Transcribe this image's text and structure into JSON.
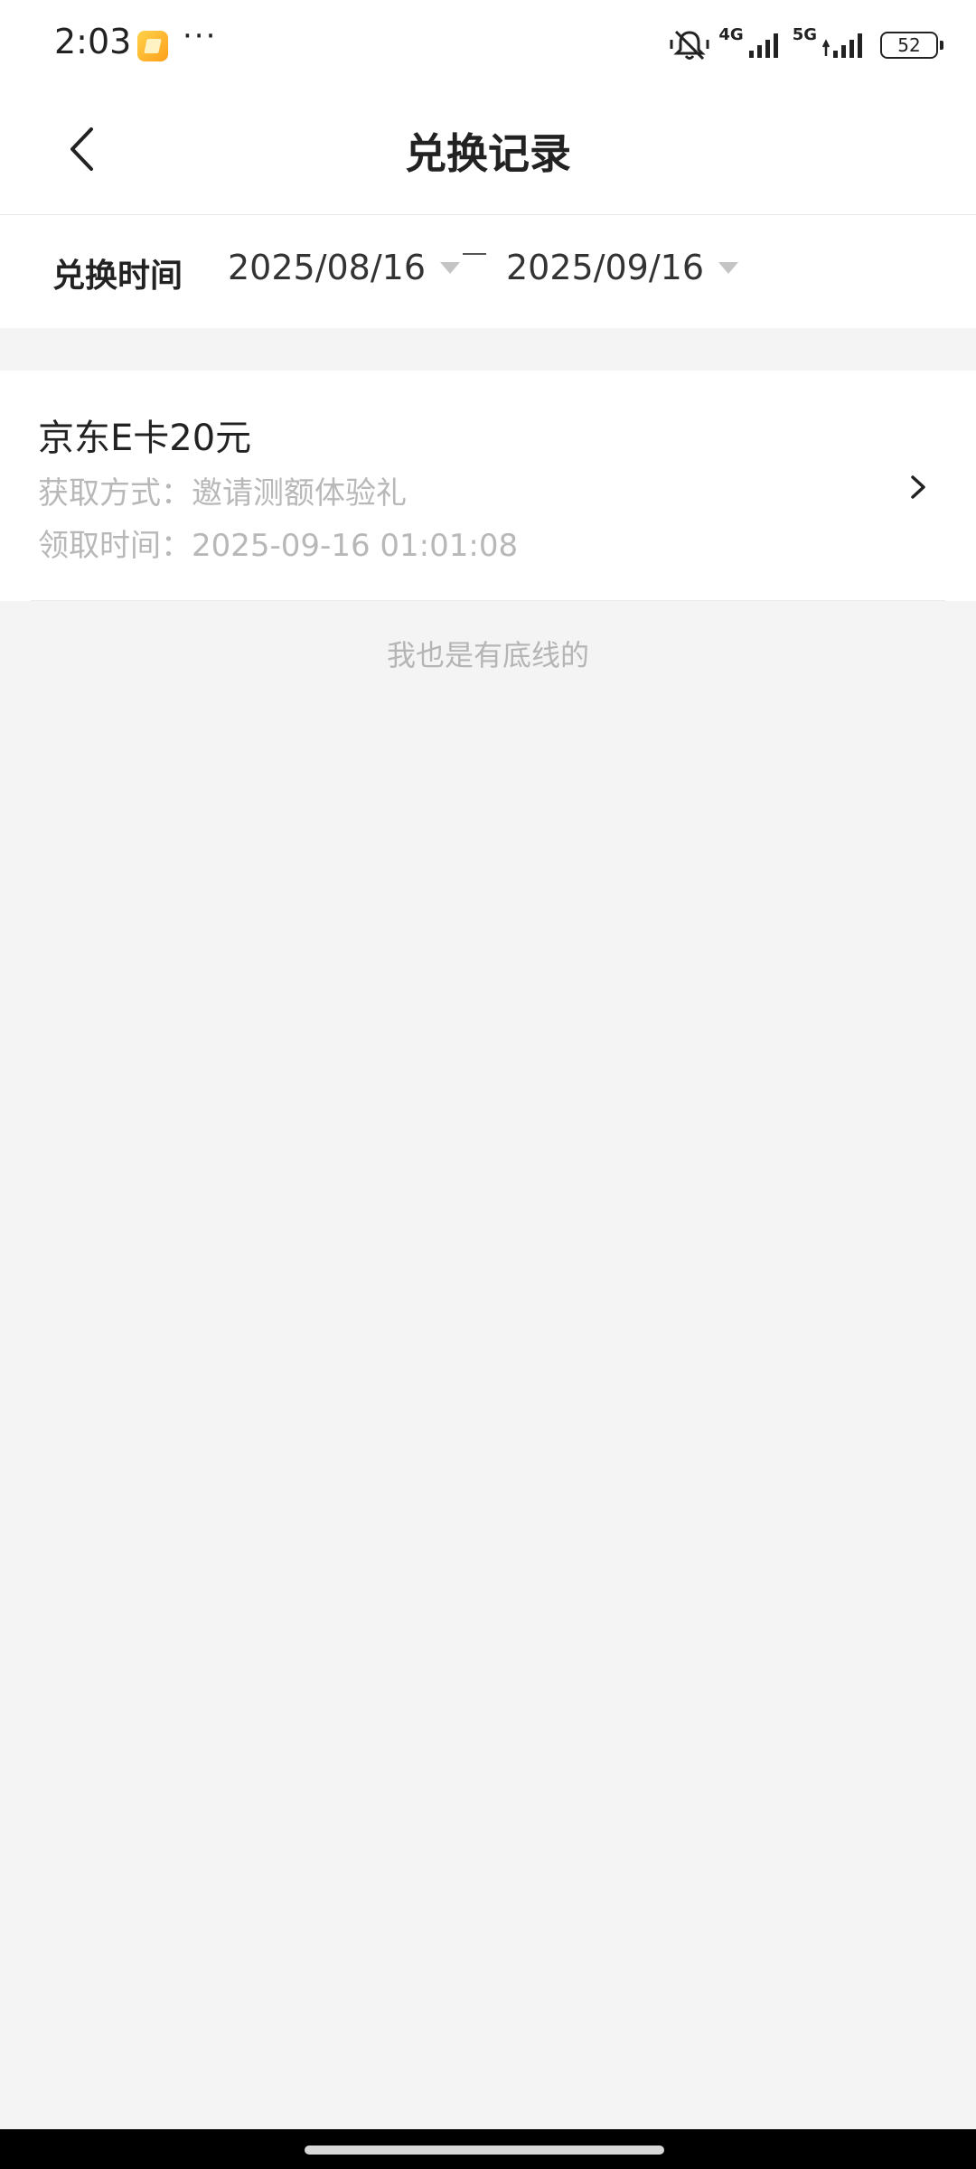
{
  "status_bar": {
    "time": "2:03",
    "more": "···",
    "network_1": "4G",
    "network_2": "5G",
    "battery": "52"
  },
  "header": {
    "title": "兑换记录"
  },
  "filter": {
    "label": "兑换时间",
    "start_date": "2025/08/16",
    "end_date": "2025/09/16"
  },
  "records": [
    {
      "title": "京东E卡20元",
      "method": "获取方式：邀请测额体验礼",
      "time": "领取时间：2025-09-16 01:01:08"
    }
  ],
  "footer": {
    "end_text": "我也是有底线的"
  },
  "colors": {
    "background": "#f4f4f4",
    "card": "#ffffff",
    "muted_text": "#b8b8b8"
  }
}
